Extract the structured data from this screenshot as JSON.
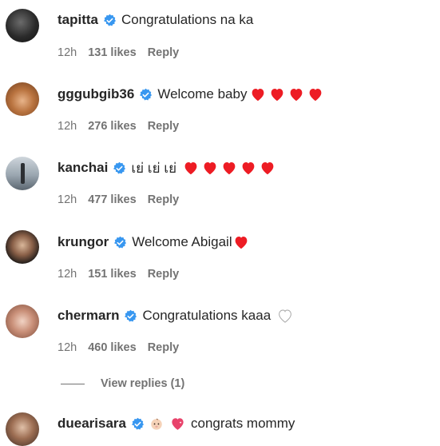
{
  "comments": [
    {
      "username": "tapitta",
      "text": "Congratulations na ka",
      "time": "12h",
      "likes": "131 likes",
      "reply": "Reply"
    },
    {
      "username": "gggubgib36",
      "text": "Welcome baby",
      "time": "12h",
      "likes": "276 likes",
      "reply": "Reply"
    },
    {
      "username": "kanchai",
      "text": "เย่ เย่ เย่",
      "time": "12h",
      "likes": "477 likes",
      "reply": "Reply"
    },
    {
      "username": "krungor",
      "text": "Welcome Abigail",
      "time": "12h",
      "likes": "151 likes",
      "reply": "Reply"
    },
    {
      "username": "chermarn",
      "text": "Congratulations kaaa",
      "time": "12h",
      "likes": "460 likes",
      "reply": "Reply"
    },
    {
      "username": "duearisara",
      "text": "congrats mommy"
    }
  ],
  "view_replies": "View replies (1)",
  "colors": {
    "verified": "#3897f0",
    "heart": "#ed1c24",
    "meta": "#737373",
    "text": "#262626"
  }
}
